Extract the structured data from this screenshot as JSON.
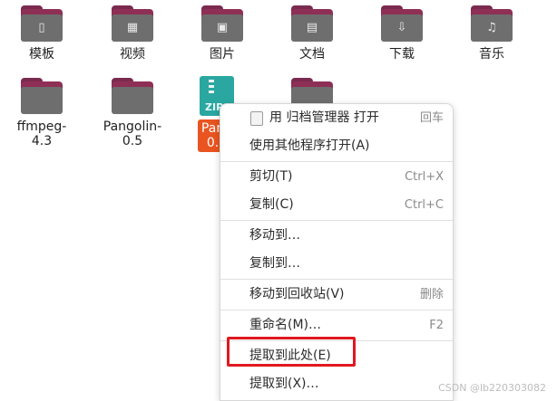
{
  "desktop": {
    "icons": [
      {
        "label": "模板",
        "glyph": "▯"
      },
      {
        "label": "视频",
        "glyph": "▦"
      },
      {
        "label": "图片",
        "glyph": "▣"
      },
      {
        "label": "文档",
        "glyph": "▤"
      },
      {
        "label": "下载",
        "glyph": "⇩"
      },
      {
        "label": "音乐",
        "glyph": "♫"
      },
      {
        "label": "ffmpeg-4.3",
        "glyph": ""
      },
      {
        "label": "Pangolin-0.5",
        "glyph": ""
      },
      {
        "label": "Pangolin-0.5",
        "glyph": ""
      },
      {
        "label": "",
        "glyph": ""
      }
    ]
  },
  "selected_zip": {
    "label_top": "Pang",
    "label_bottom": "0.5",
    "badge": "ZIP"
  },
  "context_menu": {
    "items": [
      {
        "label": "用 归档管理器 打开",
        "accel": "回车"
      },
      {
        "label": "使用其他程序打开(A)",
        "accel": ""
      },
      {
        "label": "剪切(T)",
        "accel": "Ctrl+X"
      },
      {
        "label": "复制(C)",
        "accel": "Ctrl+C"
      },
      {
        "label": "移动到…",
        "accel": ""
      },
      {
        "label": "复制到…",
        "accel": ""
      },
      {
        "label": "移动到回收站(V)",
        "accel": "删除"
      },
      {
        "label": "重命名(M)…",
        "accel": "F2"
      },
      {
        "label": "提取到此处(E)",
        "accel": ""
      },
      {
        "label": "提取到(X)…",
        "accel": ""
      }
    ]
  },
  "watermark": "CSDN @lb220303082"
}
